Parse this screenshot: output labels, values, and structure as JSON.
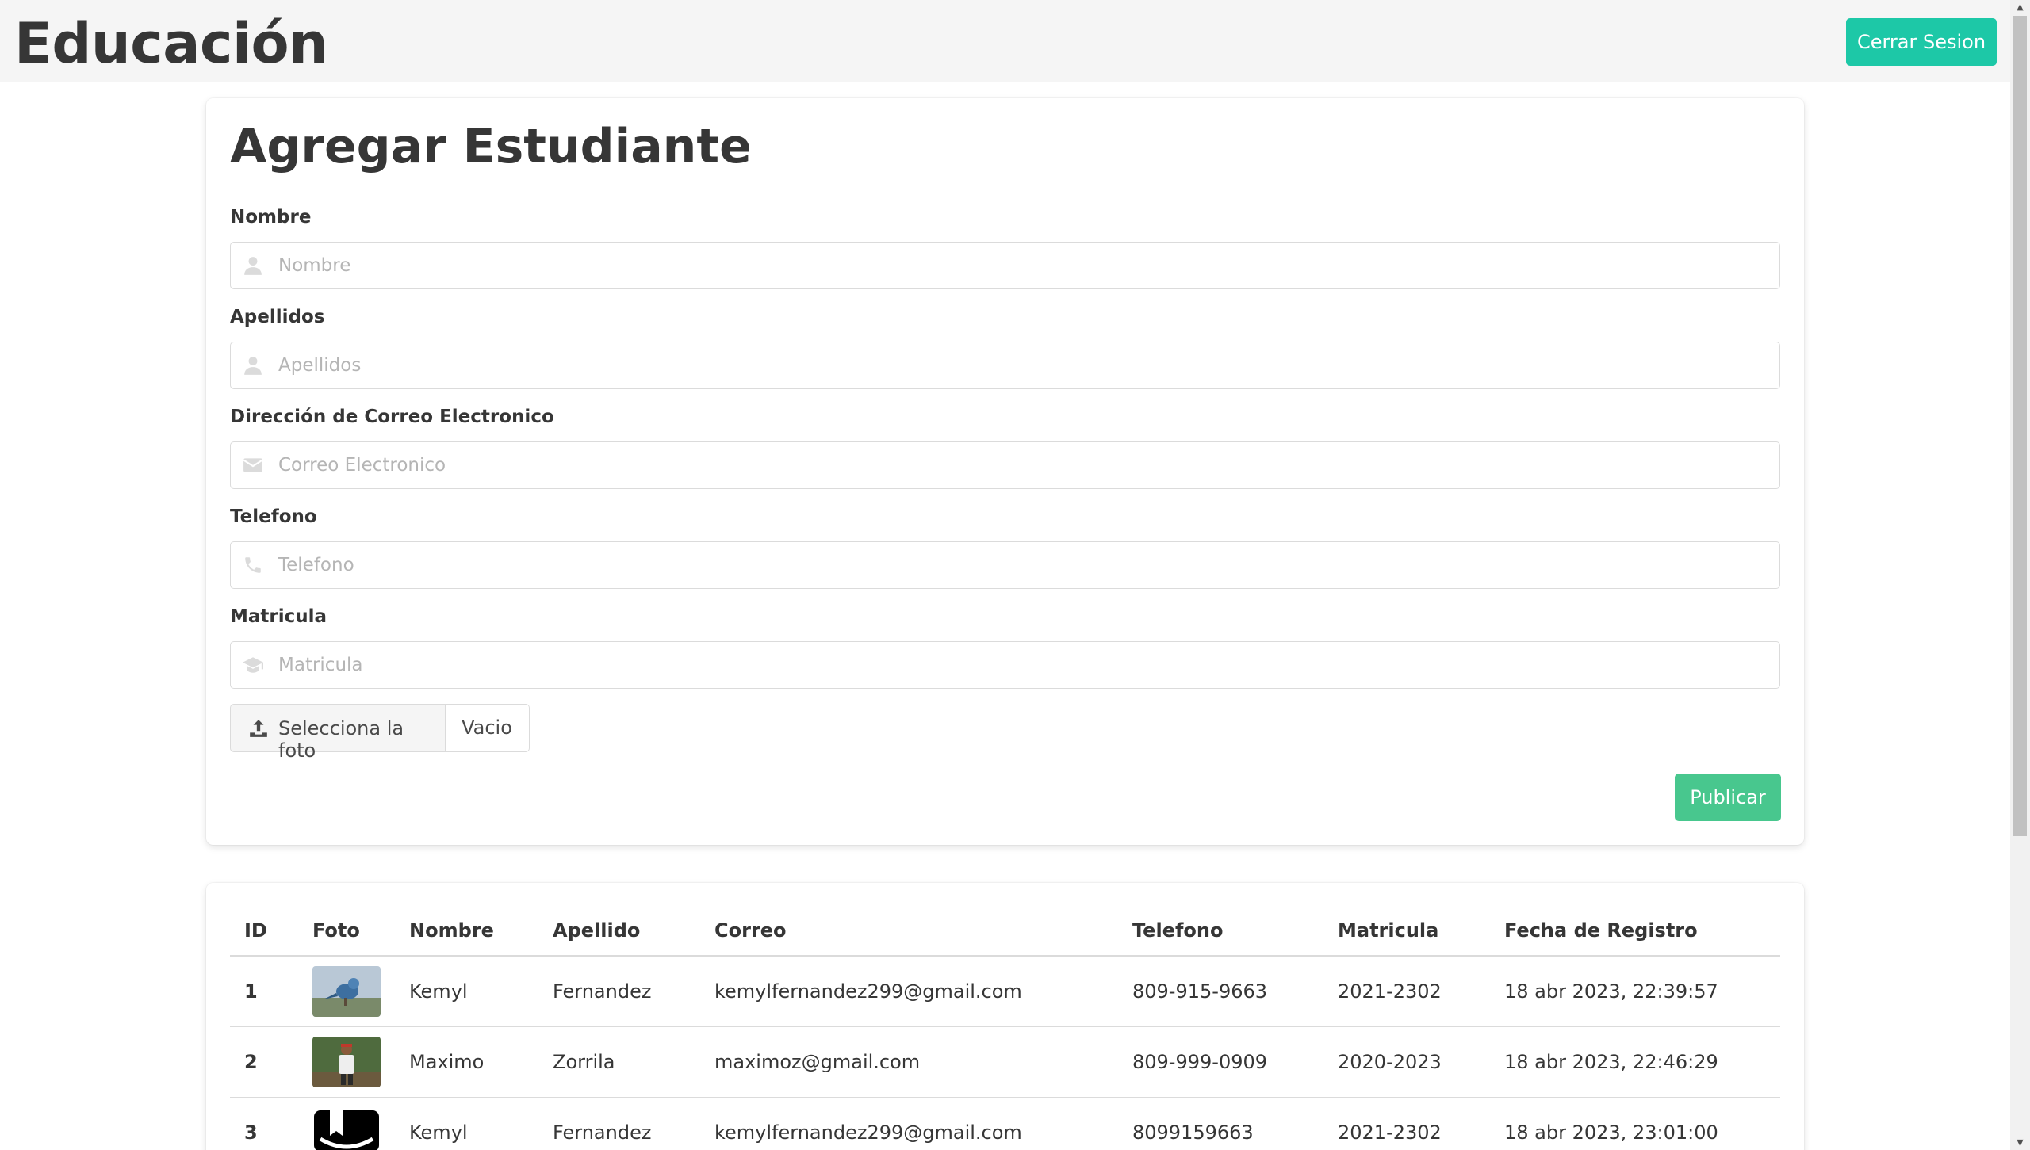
{
  "header": {
    "brand": "Educación",
    "logout_label": "Cerrar Sesion",
    "accent": "#1dc8a7"
  },
  "form": {
    "title": "Agregar Estudiante",
    "fields": [
      {
        "label": "Nombre",
        "placeholder": "Nombre",
        "icon": "user-icon"
      },
      {
        "label": "Apellidos",
        "placeholder": "Apellidos",
        "icon": "user-icon"
      },
      {
        "label": "Dirección de Correo Electronico",
        "placeholder": "Correo Electronico",
        "icon": "envelope-icon"
      },
      {
        "label": "Telefono",
        "placeholder": "Telefono",
        "icon": "phone-icon"
      },
      {
        "label": "Matricula",
        "placeholder": "Matricula",
        "icon": "graduation-cap-icon"
      }
    ],
    "file": {
      "button_label": "Selecciona la foto",
      "file_name": "Vacio",
      "icon": "upload-icon"
    },
    "submit_label": "Publicar",
    "submit_color": "#48c78e"
  },
  "table": {
    "headers": [
      "ID",
      "Foto",
      "Nombre",
      "Apellido",
      "Correo",
      "Telefono",
      "Matricula",
      "Fecha de Registro"
    ],
    "rows": [
      {
        "id": "1",
        "photo": "bird-photo",
        "nombre": "Kemyl",
        "apellido": "Fernandez",
        "correo": "kemylfernandez299@gmail.com",
        "telefono": "809-915-9663",
        "matricula": "2021-2302",
        "fecha": "18 abr 2023, 22:39:57"
      },
      {
        "id": "2",
        "photo": "person-photo",
        "nombre": "Maximo",
        "apellido": "Zorrila",
        "correo": "maximoz@gmail.com",
        "telefono": "809-999-0909",
        "matricula": "2020-2023",
        "fecha": "18 abr 2023, 22:46:29"
      },
      {
        "id": "3",
        "photo": "book-icon-photo",
        "nombre": "Kemyl",
        "apellido": "Fernandez",
        "correo": "kemylfernandez299@gmail.com",
        "telefono": "8099159663",
        "matricula": "2021-2302",
        "fecha": "18 abr 2023, 23:01:00"
      }
    ]
  }
}
